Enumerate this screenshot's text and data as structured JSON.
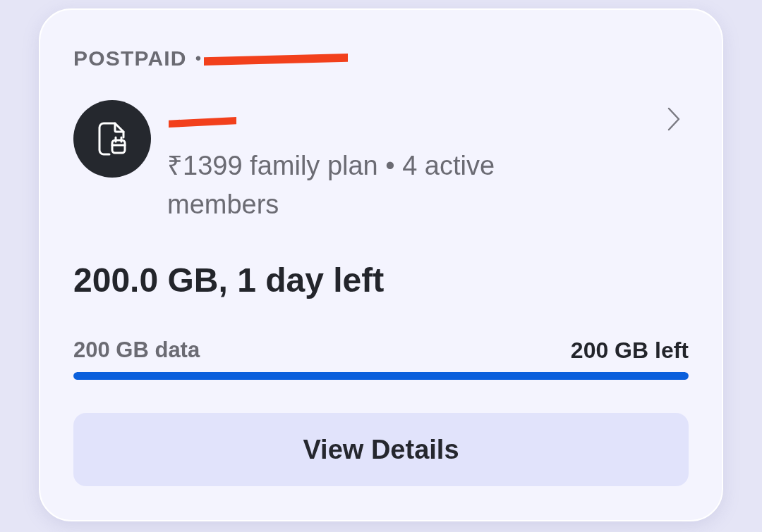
{
  "account": {
    "plan_type": "POSTPAID",
    "separator": "•",
    "number_redacted": true
  },
  "member": {
    "name_redacted": true,
    "plan": "₹1399 family plan • 4 active members"
  },
  "usage": {
    "headline": "200.0 GB, 1 day left",
    "total": "200 GB data",
    "remaining": "200 GB left",
    "level": 1
  },
  "actions": [
    {
      "label": "View Details"
    }
  ]
}
